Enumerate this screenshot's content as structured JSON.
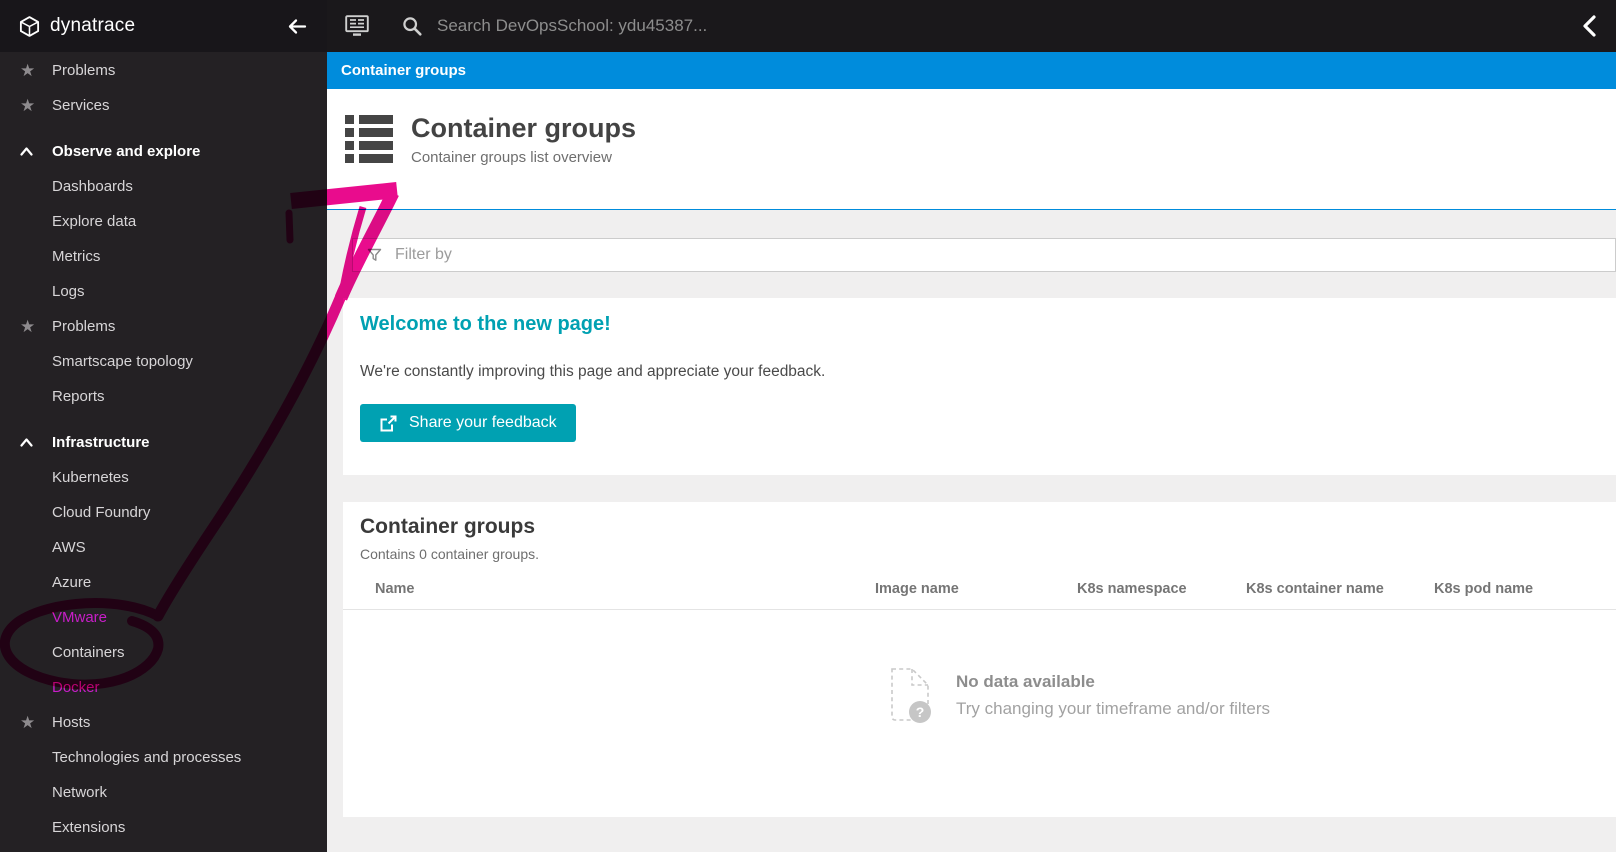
{
  "colors": {
    "accent": "#008cdc",
    "teal": "#00a1b2",
    "magenta_link": "#c81ec8",
    "annotation": "#e90c8d"
  },
  "sidebar": {
    "logo_text": "dynatrace",
    "items": [
      {
        "label": "Problems",
        "type": "favorite"
      },
      {
        "label": "Services",
        "type": "favorite"
      },
      {
        "label": "Observe and explore",
        "type": "header"
      },
      {
        "label": "Dashboards",
        "type": "link"
      },
      {
        "label": "Explore data",
        "type": "link"
      },
      {
        "label": "Metrics",
        "type": "link"
      },
      {
        "label": "Logs",
        "type": "link"
      },
      {
        "label": "Problems",
        "type": "favorite"
      },
      {
        "label": "Smartscape topology",
        "type": "link"
      },
      {
        "label": "Reports",
        "type": "link"
      },
      {
        "label": "Infrastructure",
        "type": "header"
      },
      {
        "label": "Kubernetes",
        "type": "link"
      },
      {
        "label": "Cloud Foundry",
        "type": "link"
      },
      {
        "label": "AWS",
        "type": "link"
      },
      {
        "label": "Azure",
        "type": "link"
      },
      {
        "label": "VMware",
        "type": "accent"
      },
      {
        "label": "Containers",
        "type": "link"
      },
      {
        "label": "Docker",
        "type": "accent"
      },
      {
        "label": "Hosts",
        "type": "favorite"
      },
      {
        "label": "Technologies and processes",
        "type": "link"
      },
      {
        "label": "Network",
        "type": "link"
      },
      {
        "label": "Extensions",
        "type": "link"
      }
    ]
  },
  "topbar": {
    "search_placeholder": "Search DevOpsSchool: ydu45387..."
  },
  "breadcrumb": {
    "label": "Container groups"
  },
  "page_header": {
    "title": "Container groups",
    "subtitle": "Container groups list overview"
  },
  "filter": {
    "placeholder": "Filter by"
  },
  "welcome": {
    "title": "Welcome to the new page!",
    "body": "We're constantly improving this page and appreciate your feedback.",
    "button_label": "Share your feedback"
  },
  "table": {
    "title": "Container groups",
    "subtitle": "Contains 0 container groups.",
    "columns": [
      "Name",
      "Image name",
      "K8s namespace",
      "K8s container name",
      "K8s pod name"
    ],
    "empty_title": "No data available",
    "empty_hint": "Try changing your timeframe and/or filters"
  }
}
